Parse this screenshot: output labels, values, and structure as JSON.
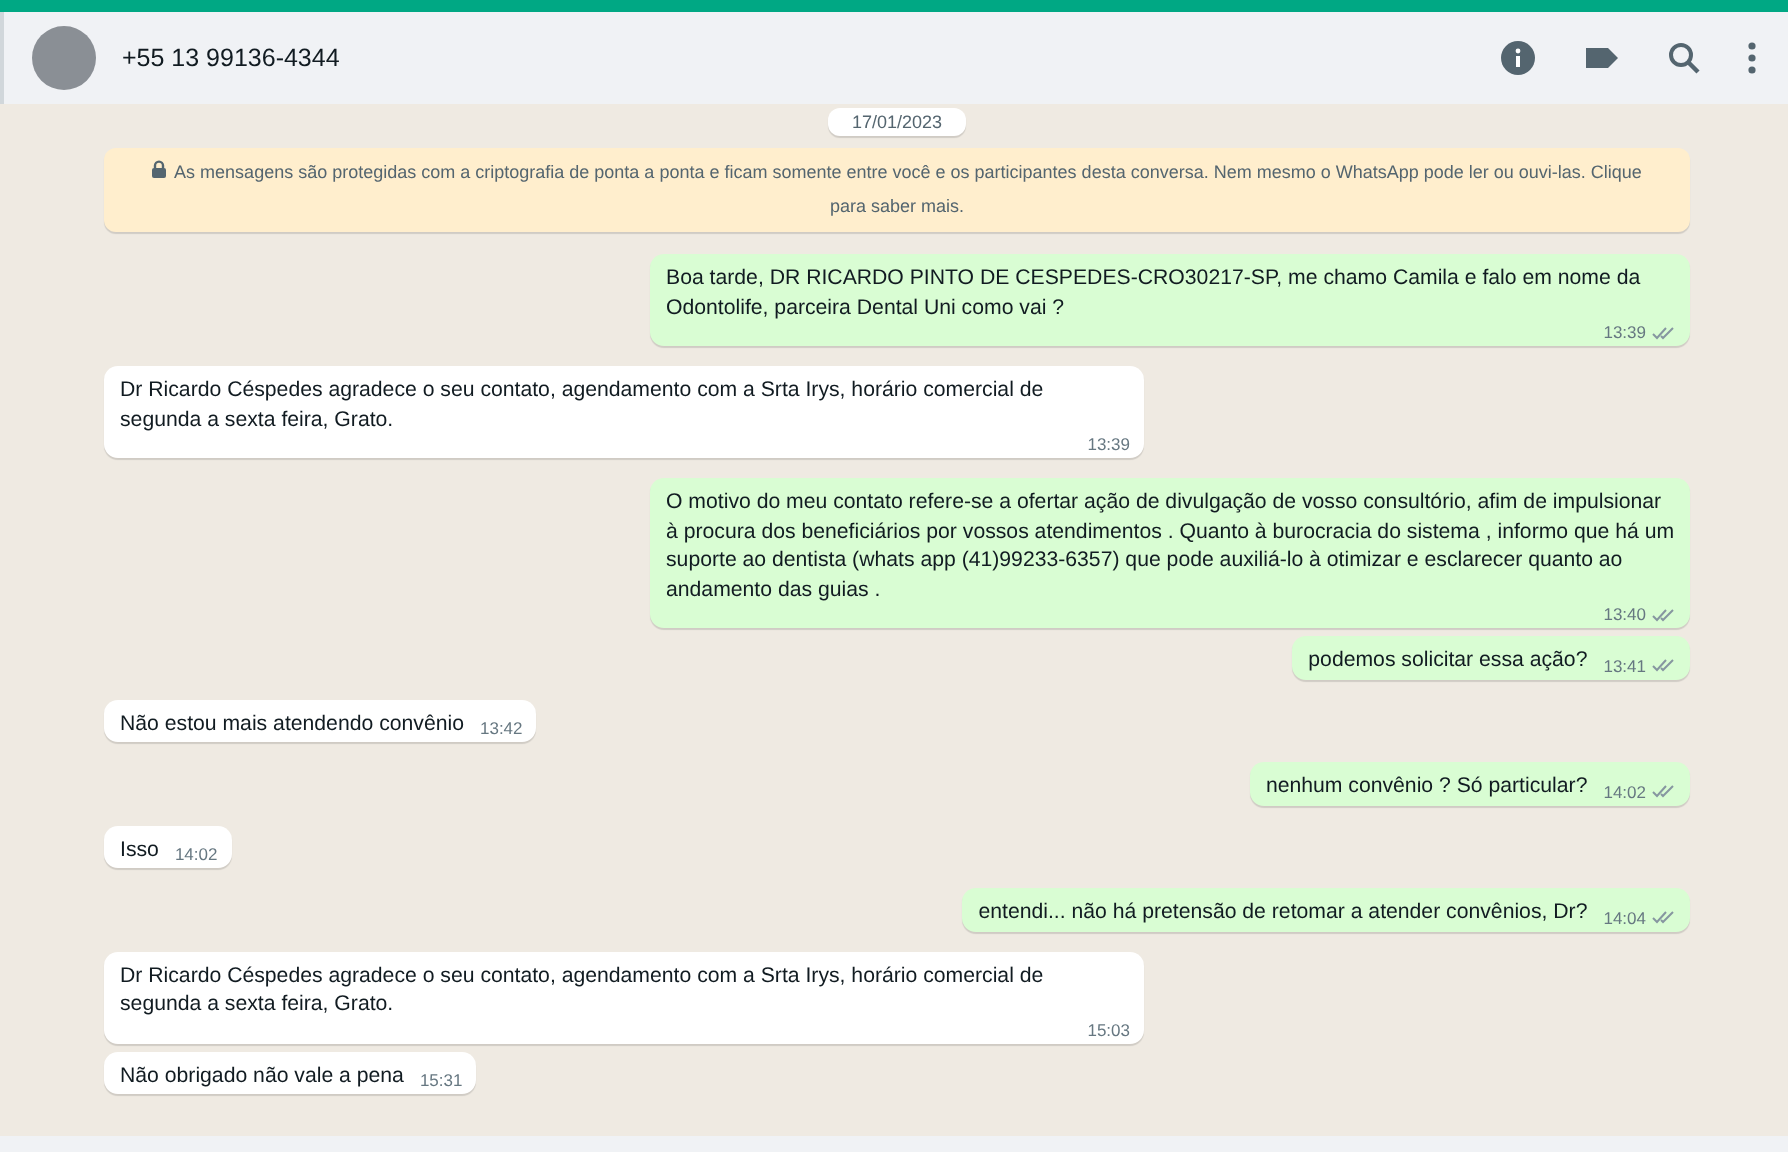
{
  "header": {
    "contact": "+55 13 99136-4344"
  },
  "date_chip": "17/01/2023",
  "encryption_notice": "As mensagens são protegidas com a criptografia de ponta a ponta e ficam somente entre você e os participantes desta conversa. Nem mesmo o WhatsApp pode ler ou ouvi-las. Clique para saber mais.",
  "messages": [
    {
      "kind": "out",
      "text": "Boa tarde, DR RICARDO PINTO DE CESPEDES-CRO30217-SP, me chamo Camila e falo em nome da Odontolife, parceira Dental Uni como vai ?",
      "time": "13:39"
    },
    {
      "kind": "in",
      "text": "Dr Ricardo Céspedes agradece o seu contato, agendamento com a Srta Irys, horário comercial de segunda a sexta feira, Grato.",
      "time": "13:39"
    },
    {
      "kind": "out",
      "text": "O motivo do meu contato refere-se a ofertar ação de divulgação de vosso consultório, afim de impulsionar à procura dos beneficiários por vossos atendimentos . Quanto à burocracia do sistema , informo que há um suporte ao dentista (whats app (41)99233-6357) que pode auxiliá-lo à otimizar e esclarecer quanto ao andamento das guias .",
      "time": "13:40"
    },
    {
      "kind": "out",
      "text": "podemos solicitar essa ação?",
      "time": "13:41"
    },
    {
      "kind": "in",
      "text": "Não estou mais atendendo convênio",
      "time": "13:42"
    },
    {
      "kind": "out",
      "text": "nenhum convênio ? Só particular?",
      "time": "14:02"
    },
    {
      "kind": "in",
      "text": "Isso",
      "time": "14:02"
    },
    {
      "kind": "out",
      "text": "entendi... não há pretensão de retomar a atender convênios, Dr?",
      "time": "14:04"
    },
    {
      "kind": "in",
      "text": "Dr Ricardo Céspedes agradece o seu contato, agendamento com a Srta Irys, horário comercial de segunda a sexta feira, Grato.",
      "time": "15:03"
    },
    {
      "kind": "in",
      "text": "Não obrigado não vale a pena",
      "time": "15:31"
    }
  ]
}
